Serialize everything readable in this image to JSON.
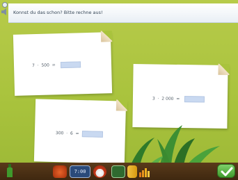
{
  "instruction": "Konnst du das schon? Bitte rechne aus!",
  "cards": [
    {
      "expression": "7  ·  500  =",
      "answer": ""
    },
    {
      "expression": "3  ·  2 000  =",
      "answer": ""
    },
    {
      "expression": "300  ·  6  =",
      "answer": ""
    }
  ],
  "toolbar": {
    "clock": "7:00"
  },
  "colors": {
    "background": "#a9c33d",
    "answer_box": "#c9d9f1",
    "toolbar": "#4a3014",
    "check": "#4fae3a"
  }
}
